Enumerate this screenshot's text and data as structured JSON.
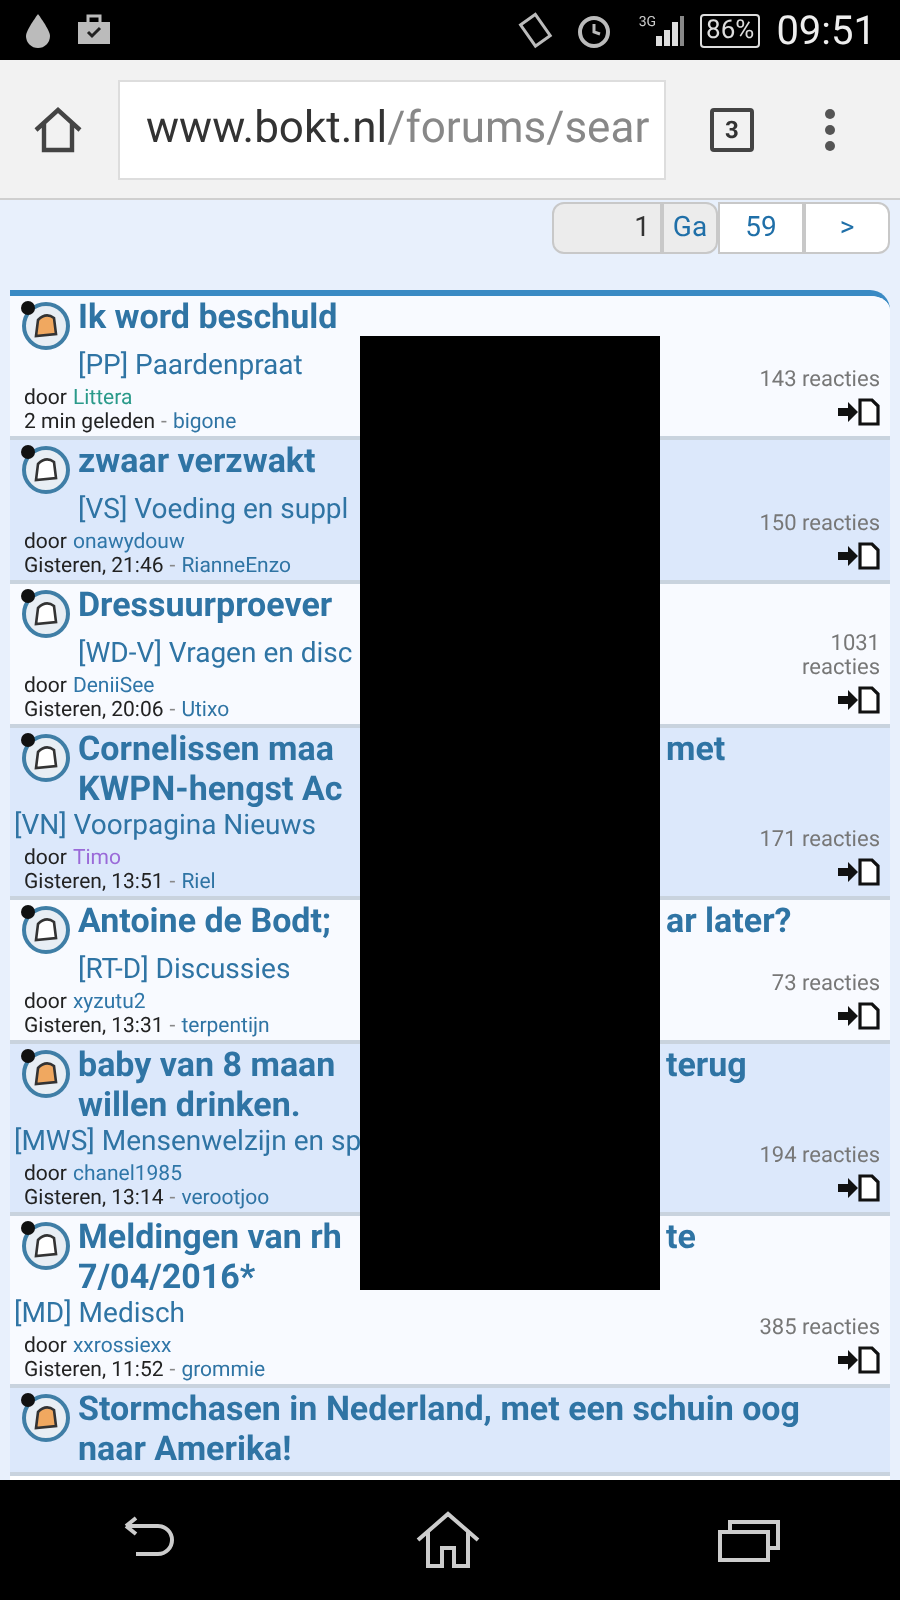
{
  "status_bar": {
    "network": "3G",
    "battery": "86%",
    "time": "09:51"
  },
  "browser": {
    "url_host": "www.bokt.nl",
    "url_path": "/forums/sear",
    "tab_count": "3"
  },
  "pagination": [
    {
      "label": "1",
      "kind": "current"
    },
    {
      "label": "Ga",
      "kind": "go"
    },
    {
      "label": "59",
      "kind": "page"
    },
    {
      "label": ">",
      "kind": "page"
    }
  ],
  "topics": [
    {
      "unread": true,
      "title_lines": [
        {
          "left": "Ik word beschuld"
        }
      ],
      "category": "[PP] Paardenpraat",
      "door": "door",
      "author": {
        "name": "Littera",
        "color": "#2a9a8a"
      },
      "date": "2 min geleden",
      "separator": "-",
      "last_poster": "bigone",
      "replies": "143 reacties"
    },
    {
      "unread": false,
      "title_lines": [
        {
          "left": "zwaar verzwakt"
        }
      ],
      "category": "[VS] Voeding en suppl",
      "door": "door",
      "author": {
        "name": "onawydouw",
        "color": "#2f76a8"
      },
      "date": "Gisteren, 21:46",
      "separator": "-",
      "last_poster": "RianneEnzo",
      "replies": "150 reacties"
    },
    {
      "unread": false,
      "title_lines": [
        {
          "left": "Dressuurproever"
        }
      ],
      "category": "[WD-V] Vragen en disc",
      "door": "door",
      "author": {
        "name": "DeniiSee",
        "color": "#2f76a8"
      },
      "date": "Gisteren, 20:06",
      "separator": "-",
      "last_poster": "Utixo",
      "replies": "1031 reacties"
    },
    {
      "unread": false,
      "title_lines": [
        {
          "left": "Cornelissen maa",
          "right": "met"
        },
        {
          "left": "KWPN-hengst Ac"
        }
      ],
      "category": "[VN] Voorpagina Nieuws",
      "door": "door",
      "author": {
        "name": "Timo",
        "color": "#9a6ad8"
      },
      "date": "Gisteren, 13:51",
      "separator": "-",
      "last_poster": "Riel",
      "replies": "171 reacties"
    },
    {
      "unread": false,
      "title_lines": [
        {
          "left": "Antoine de Bodt;",
          "right": "ar later?"
        }
      ],
      "category": "[RT-D] Discussies",
      "door": "door",
      "author": {
        "name": "xyzutu2",
        "color": "#2f76a8"
      },
      "date": "Gisteren, 13:31",
      "separator": "-",
      "last_poster": "terpentijn",
      "replies": "73 reacties"
    },
    {
      "unread": true,
      "title_lines": [
        {
          "left": "baby van 8 maan",
          "right": "terug"
        },
        {
          "left": "willen drinken."
        }
      ],
      "category": "[MWS] Mensenwelzijn en sp",
      "door": "door",
      "author": {
        "name": "chanel1985",
        "color": "#2f76a8"
      },
      "date": "Gisteren, 13:14",
      "separator": "-",
      "last_poster": "verootjoo",
      "replies": "194 reacties"
    },
    {
      "unread": false,
      "title_lines": [
        {
          "left": "Meldingen van rh",
          "right": "te"
        },
        {
          "left": "7/04/2016*"
        }
      ],
      "category": "[MD] Medisch",
      "door": "door",
      "author": {
        "name": "xxrossiexx",
        "color": "#2f76a8"
      },
      "date": "Gisteren, 11:52",
      "separator": "-",
      "last_poster": "grommie",
      "replies": "385 reacties"
    },
    {
      "unread": true,
      "title_lines": [
        {
          "left": "Stormchasen in Nederland, met een schuin oog"
        },
        {
          "left": "naar Amerika!"
        }
      ]
    }
  ]
}
